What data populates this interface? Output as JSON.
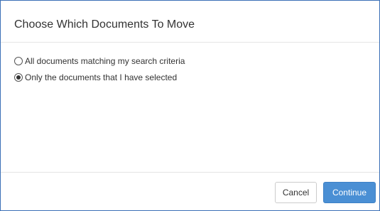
{
  "dialog": {
    "title": "Choose Which Documents To Move"
  },
  "options": [
    {
      "label": "All documents matching my search criteria",
      "selected": false
    },
    {
      "label": "Only the documents that I have selected",
      "selected": true
    }
  ],
  "footer": {
    "cancel_label": "Cancel",
    "continue_label": "Continue"
  },
  "colors": {
    "primary": "#4a8fd4",
    "border": "#3b6fb6"
  }
}
